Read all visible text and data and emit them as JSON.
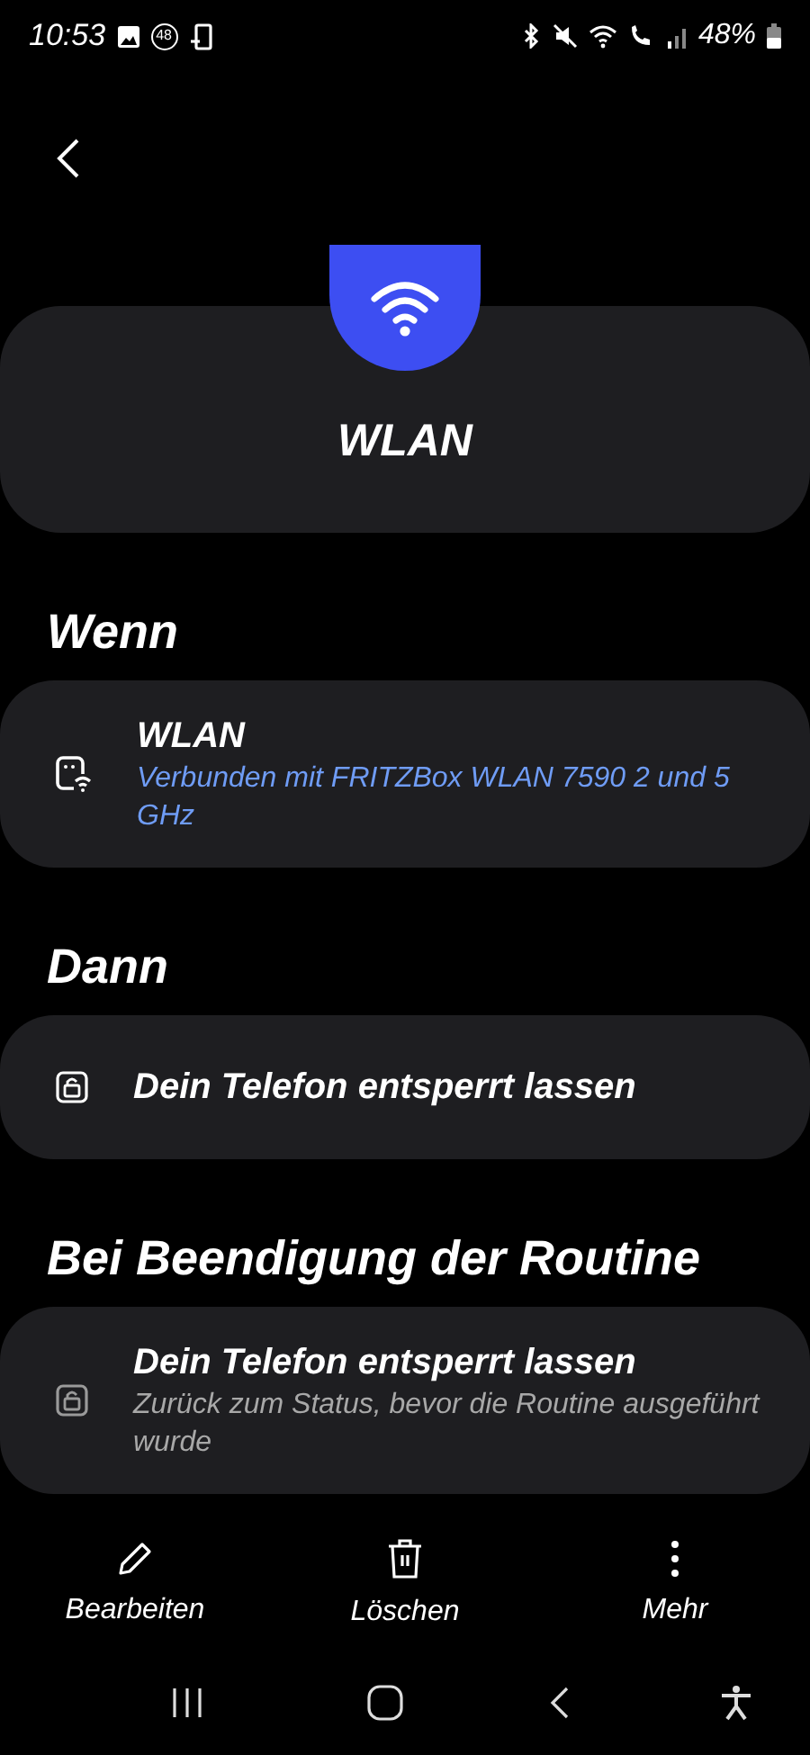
{
  "status_bar": {
    "time": "10:53",
    "notification_badge": "48",
    "battery": "48%"
  },
  "routine": {
    "title": "WLAN"
  },
  "sections": [
    {
      "heading": "Wenn",
      "items": [
        {
          "kind": "wifi",
          "title": "WLAN",
          "subtitle": "Verbunden mit FRITZBox WLAN 7590 2 und 5 GHz"
        }
      ]
    },
    {
      "heading": "Dann",
      "items": [
        {
          "kind": "lock",
          "title": "Dein Telefon entsperrt lassen"
        }
      ]
    },
    {
      "heading": "Bei Beendigung der Routine",
      "items": [
        {
          "kind": "restore",
          "title": "Dein Telefon entsperrt lassen",
          "subtitle": "Zurück zum Status, bevor die Routine ausgeführt wurde"
        }
      ]
    }
  ],
  "actions": [
    {
      "kind": "edit",
      "label": "Bearbeiten"
    },
    {
      "kind": "delete",
      "label": "Löschen"
    },
    {
      "kind": "more",
      "label": "Mehr"
    }
  ]
}
